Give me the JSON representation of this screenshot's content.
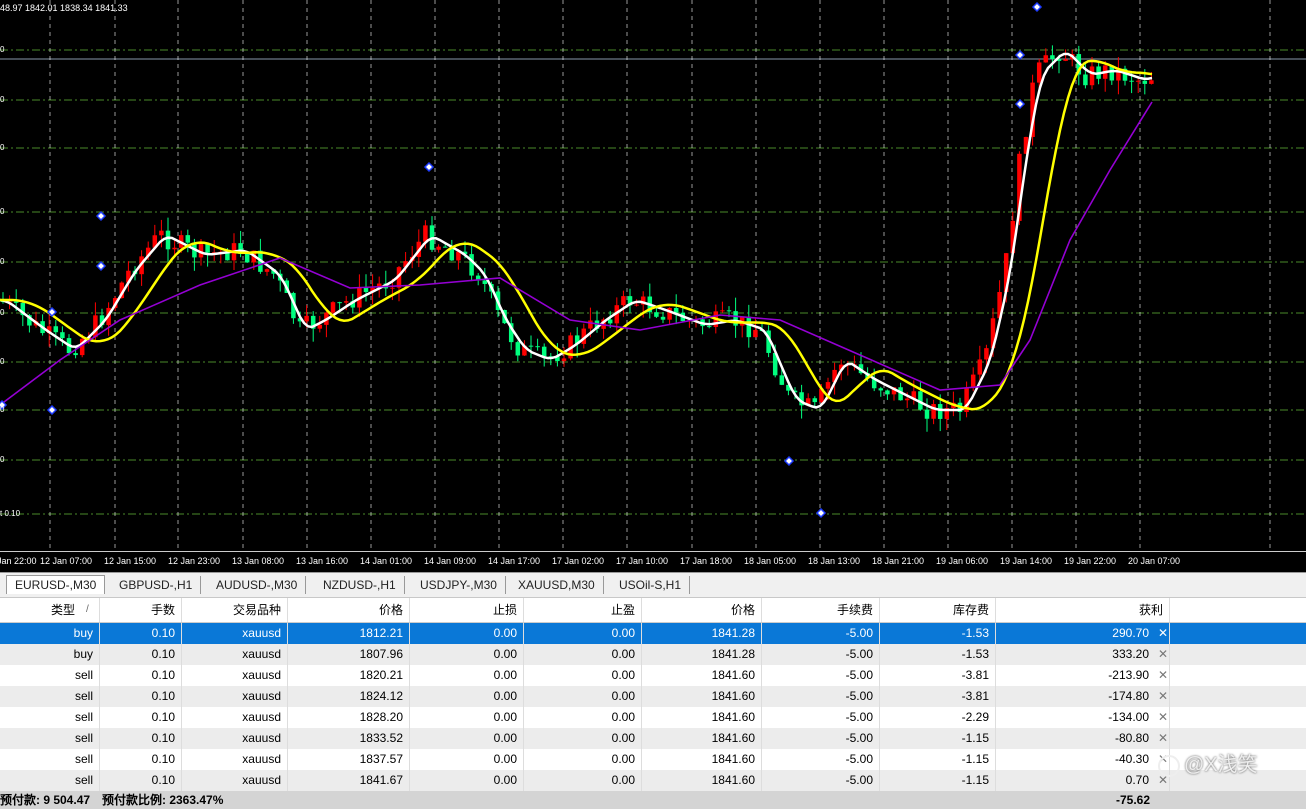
{
  "chart": {
    "ohlc_readout": "48.97 1842.01 1838.34 1841.33",
    "price_labels": [
      "0",
      "0",
      "0",
      "0",
      "0",
      "0",
      "0",
      "0",
      "0",
      "t 0.10"
    ],
    "time_labels": [
      "Jan 22:00",
      "12 Jan 07:00",
      "12 Jan 15:00",
      "12 Jan 23:00",
      "13 Jan 08:00",
      "13 Jan 16:00",
      "14 Jan 01:00",
      "14 Jan 09:00",
      "14 Jan 17:00",
      "17 Jan 02:00",
      "17 Jan 10:00",
      "17 Jan 18:00",
      "18 Jan 05:00",
      "18 Jan 13:00",
      "18 Jan 21:00",
      "19 Jan 06:00",
      "19 Jan 14:00",
      "19 Jan 22:00",
      "20 Jan 07:00"
    ],
    "colors": {
      "bull": "#ff0000",
      "bear": "#00ff7f",
      "ma_fast": "#ffffff",
      "ma_mid": "#ffff00",
      "ma_slow": "#9400d3",
      "grid": "#4a8a2a",
      "vgrid": "#ffffff",
      "fractal": "#1e3cff"
    }
  },
  "tabs": [
    {
      "label": "EURUSD-,M30",
      "active": true
    },
    {
      "label": "GBPUSD-,H1",
      "active": false
    },
    {
      "label": "AUDUSD-,M30",
      "active": false
    },
    {
      "label": "NZDUSD-,H1",
      "active": false
    },
    {
      "label": "USDJPY-,M30",
      "active": false
    },
    {
      "label": "XAUUSD,M30",
      "active": false
    },
    {
      "label": "USOil-S,H1",
      "active": false
    }
  ],
  "orders": {
    "headers": [
      "类型",
      "手数",
      "交易品种",
      "价格",
      "止损",
      "止盈",
      "价格",
      "手续费",
      "库存费",
      "获利"
    ],
    "sort_indicator": "/",
    "rows": [
      {
        "type": "buy",
        "lots": "0.10",
        "symbol": "xauusd",
        "open": "1812.21",
        "sl": "0.00",
        "tp": "0.00",
        "price": "1841.28",
        "commission": "-5.00",
        "swap": "-1.53",
        "profit": "290.70"
      },
      {
        "type": "buy",
        "lots": "0.10",
        "symbol": "xauusd",
        "open": "1807.96",
        "sl": "0.00",
        "tp": "0.00",
        "price": "1841.28",
        "commission": "-5.00",
        "swap": "-1.53",
        "profit": "333.20"
      },
      {
        "type": "sell",
        "lots": "0.10",
        "symbol": "xauusd",
        "open": "1820.21",
        "sl": "0.00",
        "tp": "0.00",
        "price": "1841.60",
        "commission": "-5.00",
        "swap": "-3.81",
        "profit": "-213.90"
      },
      {
        "type": "sell",
        "lots": "0.10",
        "symbol": "xauusd",
        "open": "1824.12",
        "sl": "0.00",
        "tp": "0.00",
        "price": "1841.60",
        "commission": "-5.00",
        "swap": "-3.81",
        "profit": "-174.80"
      },
      {
        "type": "sell",
        "lots": "0.10",
        "symbol": "xauusd",
        "open": "1828.20",
        "sl": "0.00",
        "tp": "0.00",
        "price": "1841.60",
        "commission": "-5.00",
        "swap": "-2.29",
        "profit": "-134.00"
      },
      {
        "type": "sell",
        "lots": "0.10",
        "symbol": "xauusd",
        "open": "1833.52",
        "sl": "0.00",
        "tp": "0.00",
        "price": "1841.60",
        "commission": "-5.00",
        "swap": "-1.15",
        "profit": "-80.80"
      },
      {
        "type": "sell",
        "lots": "0.10",
        "symbol": "xauusd",
        "open": "1837.57",
        "sl": "0.00",
        "tp": "0.00",
        "price": "1841.60",
        "commission": "-5.00",
        "swap": "-1.15",
        "profit": "-40.30"
      },
      {
        "type": "sell",
        "lots": "0.10",
        "symbol": "xauusd",
        "open": "1841.67",
        "sl": "0.00",
        "tp": "0.00",
        "price": "1841.60",
        "commission": "-5.00",
        "swap": "-1.15",
        "profit": "0.70"
      }
    ],
    "summary": {
      "margin_text": "预付款: 9 504.47",
      "margin_level_text": "预付款比例: 2363.47%",
      "total_profit": "-75.62"
    }
  },
  "watermark": "@X浅笑"
}
